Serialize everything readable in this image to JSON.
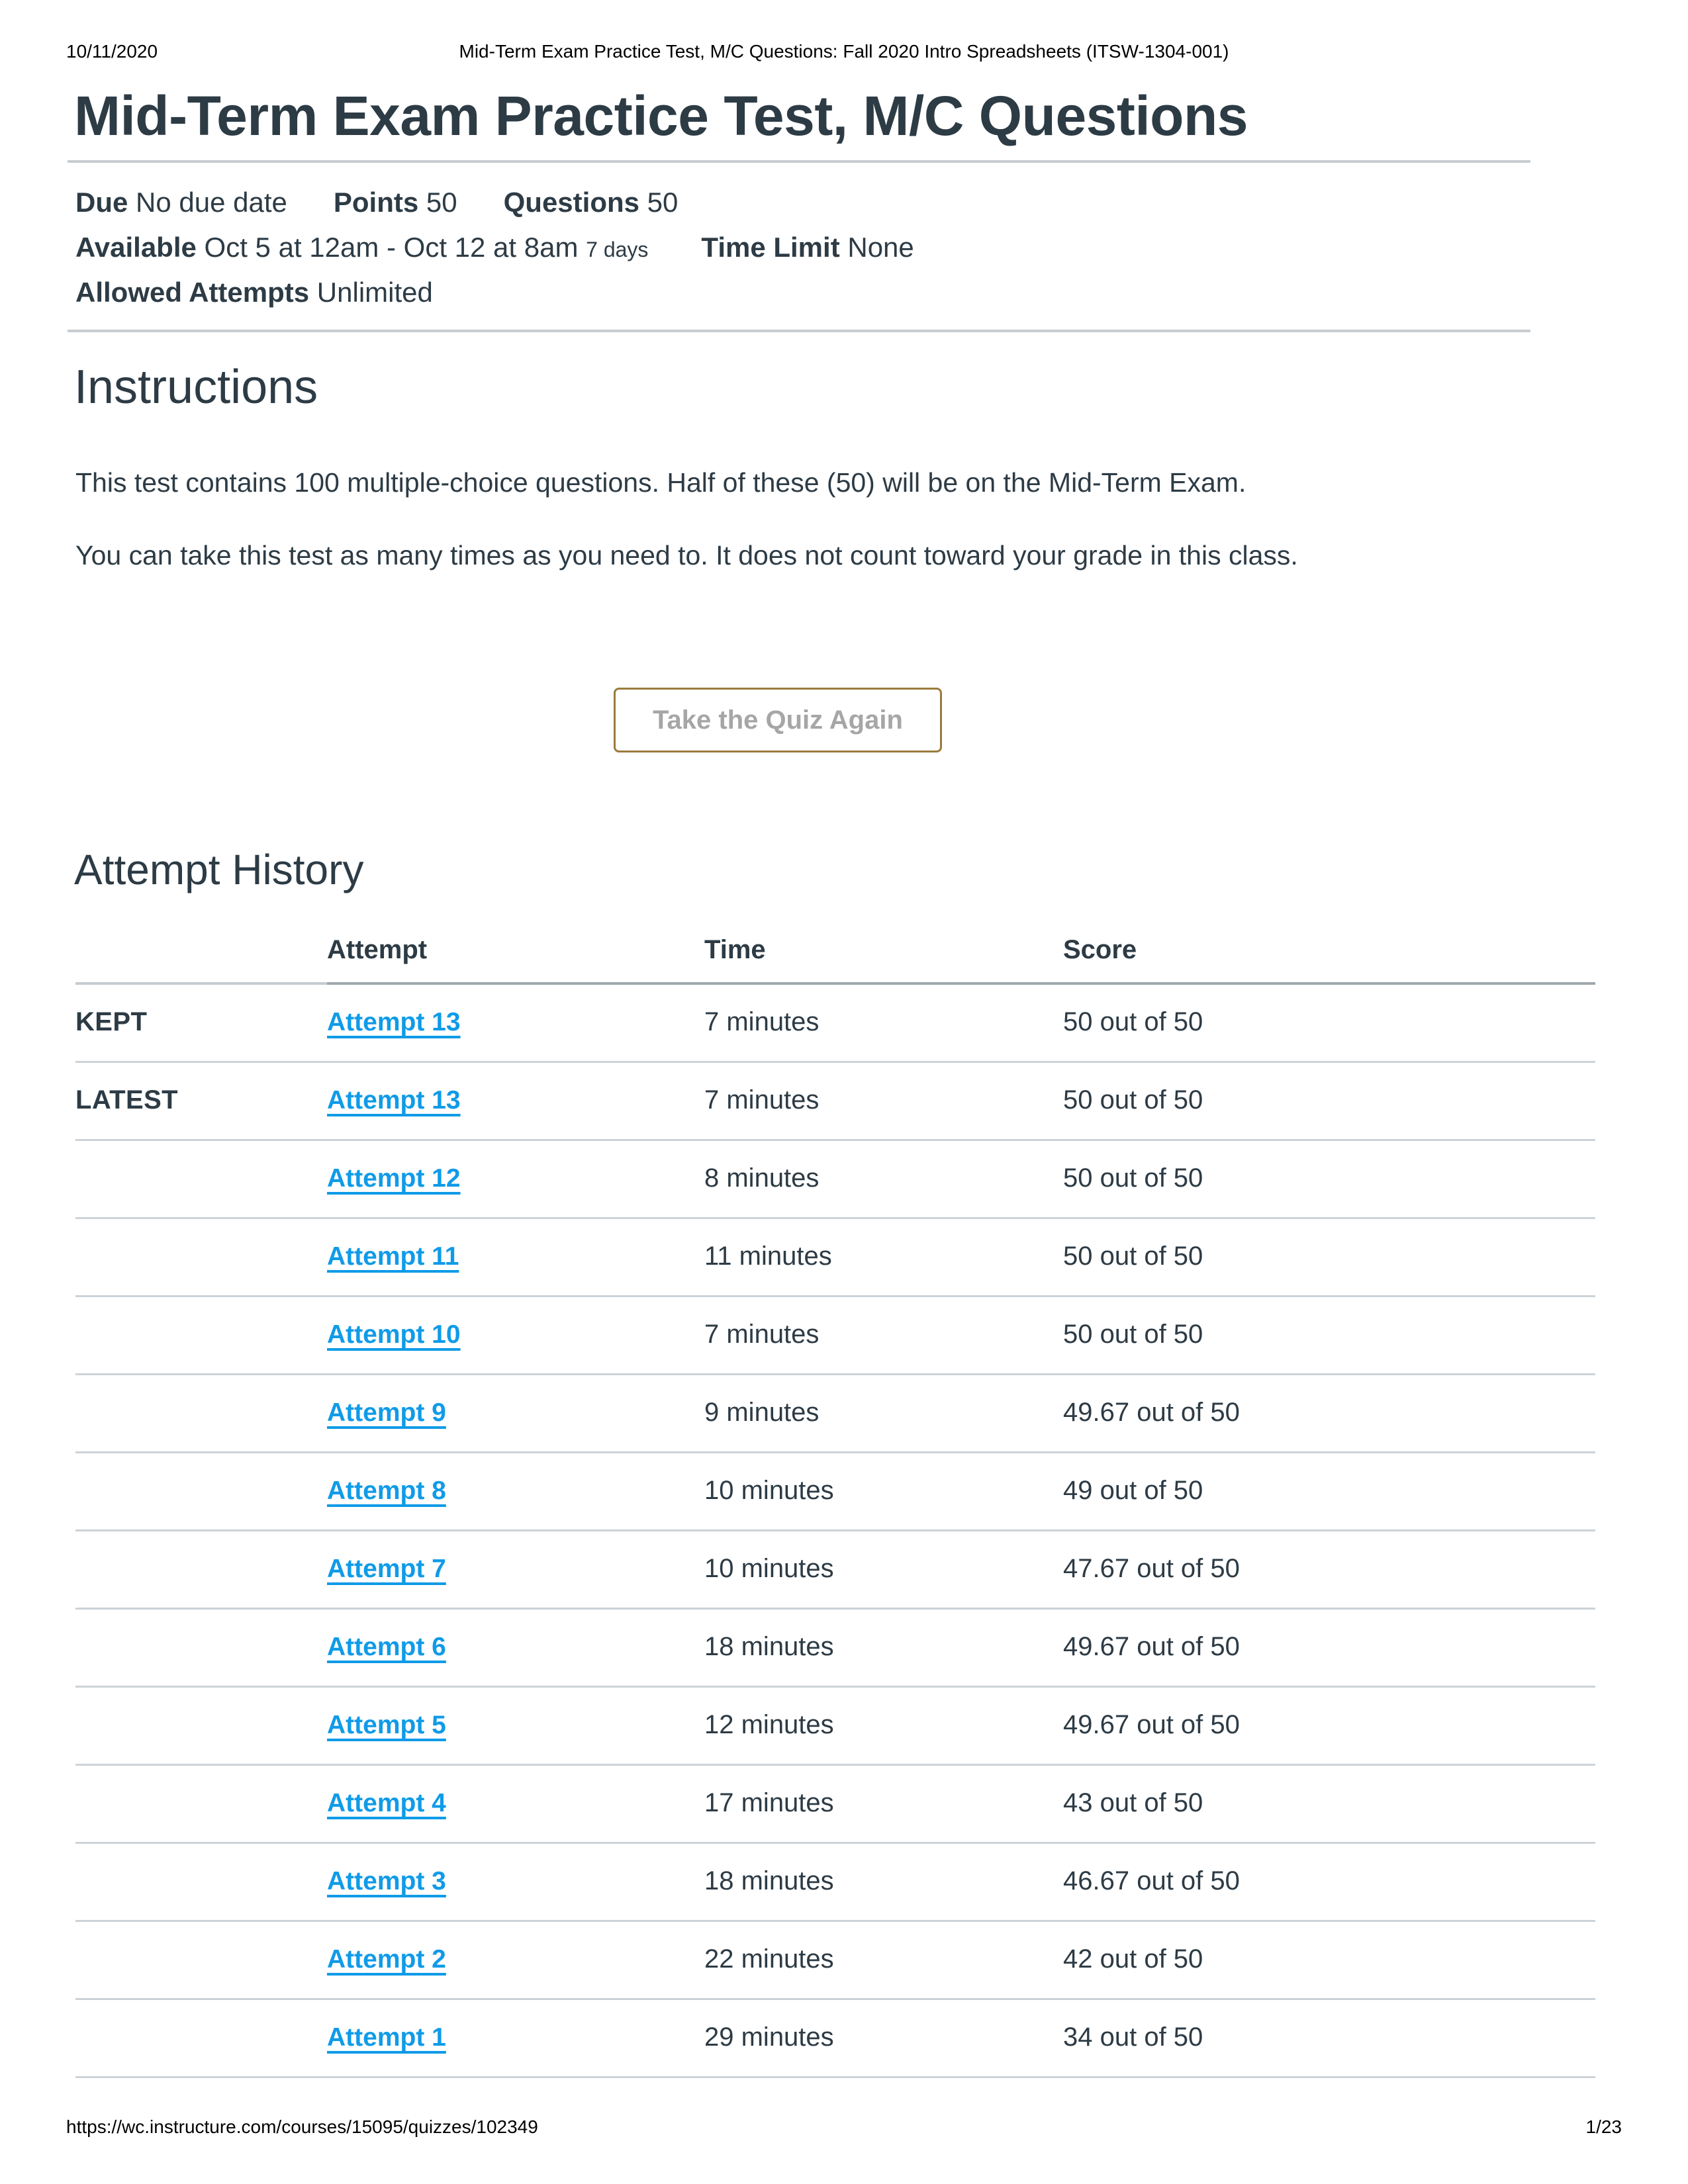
{
  "print_header": {
    "date": "10/11/2020",
    "title": "Mid-Term Exam Practice Test, M/C Questions: Fall 2020 Intro Spreadsheets (ITSW-1304-001)"
  },
  "page_title": "Mid-Term Exam Practice Test, M/C Questions",
  "meta": {
    "due_label": "Due",
    "due_value": "No due date",
    "points_label": "Points",
    "points_value": "50",
    "questions_label": "Questions",
    "questions_value": "50",
    "available_label": "Available",
    "available_value": "Oct 5 at 12am - Oct 12 at 8am",
    "available_duration": "7 days",
    "time_limit_label": "Time Limit",
    "time_limit_value": "None",
    "allowed_attempts_label": "Allowed Attempts",
    "allowed_attempts_value": "Unlimited"
  },
  "instructions": {
    "heading": "Instructions",
    "paragraph_1": "This test contains 100 multiple-choice questions. Half of these (50) will be on the Mid-Term Exam.",
    "paragraph_2": "You can take this test as many times as you need to. It does not count toward your grade in this class."
  },
  "retake_button": {
    "label": "Take the Quiz Again"
  },
  "attempt_history": {
    "heading": "Attempt History",
    "columns": {
      "label": "",
      "attempt": "Attempt",
      "time": "Time",
      "score": "Score"
    },
    "rows": [
      {
        "label": "KEPT",
        "attempt": "Attempt 13 ",
        "time": "7 minutes",
        "score": "50 out of 50"
      },
      {
        "label": "LATEST",
        "attempt": "Attempt 13 ",
        "time": "7 minutes",
        "score": "50 out of 50"
      },
      {
        "label": "",
        "attempt": "Attempt 12 ",
        "time": "8 minutes",
        "score": "50 out of 50"
      },
      {
        "label": "",
        "attempt": "Attempt 11 ",
        "time": "11 minutes",
        "score": "50 out of 50"
      },
      {
        "label": "",
        "attempt": "Attempt 10 ",
        "time": "7 minutes",
        "score": "50 out of 50"
      },
      {
        "label": "",
        "attempt": "Attempt 9 ",
        "time": "9 minutes",
        "score": "49.67 out of 50"
      },
      {
        "label": "",
        "attempt": "Attempt 8 ",
        "time": "10 minutes",
        "score": "49 out of 50"
      },
      {
        "label": "",
        "attempt": "Attempt 7 ",
        "time": "10 minutes",
        "score": "47.67 out of 50"
      },
      {
        "label": "",
        "attempt": "Attempt 6 ",
        "time": "18 minutes",
        "score": "49.67 out of 50"
      },
      {
        "label": "",
        "attempt": "Attempt 5 ",
        "time": "12 minutes",
        "score": "49.67 out of 50"
      },
      {
        "label": "",
        "attempt": "Attempt 4 ",
        "time": "17 minutes",
        "score": "43 out of 50"
      },
      {
        "label": "",
        "attempt": "Attempt 3 ",
        "time": "18 minutes",
        "score": "46.67 out of 50"
      },
      {
        "label": "",
        "attempt": "Attempt 2 ",
        "time": "22 minutes",
        "score": "42 out of 50"
      },
      {
        "label": "",
        "attempt": "Attempt 1 ",
        "time": "29 minutes",
        "score": "34 out of 50"
      }
    ]
  },
  "print_footer": {
    "url": "https://wc.instructure.com/courses/15095/quizzes/102349",
    "page_number": "1/23"
  },
  "colors": {
    "link": "#0f9be8",
    "button_border": "#9b7b3c",
    "button_text": "#a6a6a6",
    "rule": "#c7cdd1",
    "text": "#2d3b45"
  }
}
